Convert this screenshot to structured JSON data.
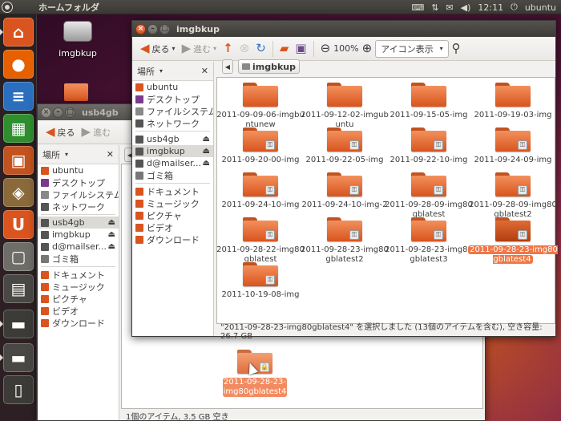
{
  "top_panel": {
    "title": "ホームフォルダ",
    "clock": "12:11",
    "user": "ubuntu",
    "indicators": [
      "keyboard-icon",
      "network-icon",
      "mail-icon",
      "volume-icon",
      "power-icon"
    ]
  },
  "launcher": {
    "items": [
      {
        "name": "home-folder-launcher",
        "glyph": "⌂",
        "color": "#d9541e"
      },
      {
        "name": "firefox-launcher",
        "glyph": "●",
        "color": "#e66000"
      },
      {
        "name": "writer-launcher",
        "glyph": "≡",
        "color": "#2a6ebd"
      },
      {
        "name": "calc-launcher",
        "glyph": "▦",
        "color": "#2f8f2f"
      },
      {
        "name": "impress-launcher",
        "glyph": "▣",
        "color": "#c2521f"
      },
      {
        "name": "software-center-launcher",
        "glyph": "◈",
        "color": "#8a6a3a"
      },
      {
        "name": "ubuntu-one-launcher",
        "glyph": "U",
        "color": "#d9541e"
      },
      {
        "name": "screenshot-launcher",
        "glyph": "▢",
        "color": "#6f6d68"
      },
      {
        "name": "workspaces-launcher",
        "glyph": "▤",
        "color": "#4a4844"
      },
      {
        "name": "usb4gb-launcher",
        "glyph": "▬",
        "color": "#3c3b37"
      },
      {
        "name": "imgbkup-launcher",
        "glyph": "▬",
        "color": "#4a4844"
      },
      {
        "name": "trash-launcher",
        "glyph": "▯",
        "color": "#3c3b37"
      }
    ]
  },
  "desktop": {
    "icon_label": "imgbkup"
  },
  "main_window": {
    "title": "imgbkup",
    "toolbar": {
      "back": "戻る",
      "forward": "進む",
      "zoom": "100%",
      "view_mode": "アイコン表示"
    },
    "sidebar": {
      "header": "場所",
      "places": [
        {
          "label": "ubuntu",
          "icon": "home-icon",
          "color": "#d9541e"
        },
        {
          "label": "デスクトップ",
          "icon": "desktop-icon",
          "color": "#7a3a8c"
        },
        {
          "label": "ファイルシステム",
          "icon": "filesystem-icon",
          "color": "#888"
        },
        {
          "label": "ネットワーク",
          "icon": "network-icon",
          "color": "#555"
        }
      ],
      "devices": [
        {
          "label": "usb4gb",
          "icon": "usb-drive-icon",
          "color": "#555",
          "eject": true,
          "selected": false
        },
        {
          "label": "imgbkup",
          "icon": "drive-icon",
          "color": "#555",
          "eject": true,
          "selected": true
        },
        {
          "label": "d@mailser...",
          "icon": "network-share-icon",
          "color": "#555",
          "eject": true,
          "selected": false
        },
        {
          "label": "ゴミ箱",
          "icon": "trash-icon",
          "color": "#777",
          "eject": false,
          "selected": false
        }
      ],
      "bookmarks": [
        {
          "label": "ドキュメント",
          "icon": "documents-icon",
          "color": "#d9541e"
        },
        {
          "label": "ミュージック",
          "icon": "music-icon",
          "color": "#d9541e"
        },
        {
          "label": "ピクチャ",
          "icon": "pictures-icon",
          "color": "#d9541e"
        },
        {
          "label": "ビデオ",
          "icon": "videos-icon",
          "color": "#d9541e"
        },
        {
          "label": "ダウンロード",
          "icon": "downloads-icon",
          "color": "#d9541e"
        }
      ]
    },
    "breadcrumb": "imgbkup",
    "files": [
      {
        "label": "2011-09-09-06-imgbuntunew",
        "locked": false,
        "selected": false
      },
      {
        "label": "2011-09-12-02-imgubuntu",
        "locked": false,
        "selected": false
      },
      {
        "label": "2011-09-15-05-img",
        "locked": false,
        "selected": false
      },
      {
        "label": "2011-09-19-03-img",
        "locked": false,
        "selected": false
      },
      {
        "label": "2011-09-20-00-img",
        "locked": true,
        "selected": false
      },
      {
        "label": "2011-09-22-05-img",
        "locked": true,
        "selected": false
      },
      {
        "label": "2011-09-22-10-img",
        "locked": true,
        "selected": false
      },
      {
        "label": "2011-09-24-09-img",
        "locked": true,
        "selected": false
      },
      {
        "label": "2011-09-24-10-img",
        "locked": true,
        "selected": false
      },
      {
        "label": "2011-09-24-10-img-2",
        "locked": true,
        "selected": false
      },
      {
        "label": "2011-09-28-09-img80gblatest",
        "locked": true,
        "selected": false
      },
      {
        "label": "2011-09-28-09-img80gblatest2",
        "locked": true,
        "selected": false
      },
      {
        "label": "2011-09-28-22-img80gblatest",
        "locked": true,
        "selected": false
      },
      {
        "label": "2011-09-28-23-img80gblatest2",
        "locked": true,
        "selected": false
      },
      {
        "label": "2011-09-28-23-img80gblatest3",
        "locked": true,
        "selected": false
      },
      {
        "label": "2011-09-28-23-img80gblatest4",
        "locked": true,
        "selected": true
      },
      {
        "label": "2011-10-19-08-img",
        "locked": true,
        "selected": false
      }
    ],
    "status": "\"2011-09-28-23-img80gblatest4\" を選択しました (13個のアイテムを含む), 空き容量: 26.7 GB"
  },
  "back_window": {
    "title": "usb4gb",
    "toolbar": {
      "back": "戻る",
      "forward": "進む"
    },
    "sidebar": {
      "header": "場所",
      "places": [
        {
          "label": "ubuntu",
          "icon": "home-icon",
          "color": "#d9541e"
        },
        {
          "label": "デスクトップ",
          "icon": "desktop-icon",
          "color": "#7a3a8c"
        },
        {
          "label": "ファイルシステム",
          "icon": "filesystem-icon",
          "color": "#888"
        },
        {
          "label": "ネットワーク",
          "icon": "network-icon",
          "color": "#555"
        }
      ],
      "devices": [
        {
          "label": "usb4gb",
          "icon": "usb-drive-icon",
          "color": "#555",
          "eject": true,
          "selected": true
        },
        {
          "label": "imgbkup",
          "icon": "drive-icon",
          "color": "#555",
          "eject": true,
          "selected": false
        },
        {
          "label": "d@mailser...",
          "icon": "network-share-icon",
          "color": "#555",
          "eject": true,
          "selected": false
        },
        {
          "label": "ゴミ箱",
          "icon": "trash-icon",
          "color": "#777",
          "eject": false,
          "selected": false
        }
      ],
      "bookmarks": [
        {
          "label": "ドキュメント",
          "icon": "documents-icon",
          "color": "#d9541e"
        },
        {
          "label": "ミュージック",
          "icon": "music-icon",
          "color": "#d9541e"
        },
        {
          "label": "ピクチャ",
          "icon": "pictures-icon",
          "color": "#d9541e"
        },
        {
          "label": "ビデオ",
          "icon": "videos-icon",
          "color": "#d9541e"
        },
        {
          "label": "ダウンロード",
          "icon": "downloads-icon",
          "color": "#d9541e"
        }
      ]
    },
    "drag_item_label": "2011-09-28-23-img80gblatest4",
    "status": "1個のアイテム, 3.5 GB 空き"
  }
}
